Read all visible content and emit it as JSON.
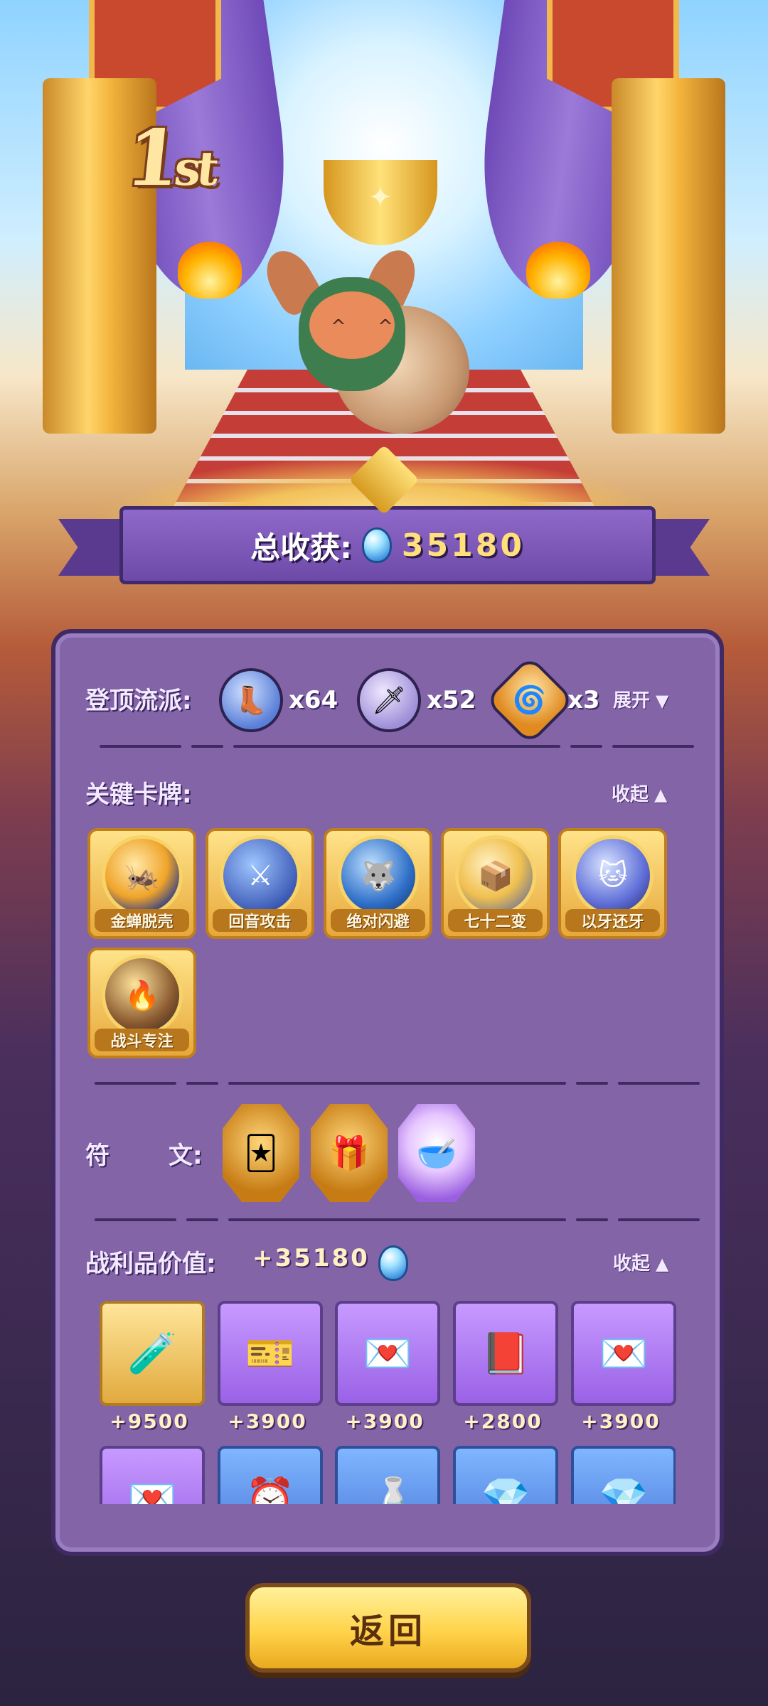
{
  "rank": {
    "num": "1",
    "suffix": "st"
  },
  "total": {
    "label": "总收获:",
    "value": "35180"
  },
  "faction": {
    "label": "登顶流派:",
    "items": [
      {
        "icon": "boot-icon",
        "count": "x64"
      },
      {
        "icon": "sword-icon",
        "count": "x52"
      },
      {
        "icon": "swirl-icon",
        "count": "x3"
      }
    ],
    "toggle": "展开"
  },
  "key_cards": {
    "label": "关键卡牌:",
    "toggle": "收起",
    "items": [
      "金蝉脱壳",
      "回音攻击",
      "绝对闪避",
      "七十二变",
      "以牙还牙",
      "战斗专注"
    ]
  },
  "runes": {
    "label_a": "符",
    "label_b": "文:"
  },
  "loot": {
    "label": "战利品价值:",
    "value": "+35180",
    "toggle": "收起",
    "items": [
      {
        "icon": "potion-icon",
        "value": "+9500"
      },
      {
        "icon": "vip-ticket-icon",
        "value": "+3900"
      },
      {
        "icon": "letter-icon",
        "value": "+3900"
      },
      {
        "icon": "red-book-icon",
        "value": "+2800"
      },
      {
        "icon": "letter-icon",
        "value": "+3900"
      }
    ],
    "partial_items": [
      "letter-icon",
      "alarm-clock-icon",
      "bottle-icon",
      "crystal-icon",
      "crystal-icon"
    ]
  },
  "back_button": "返回"
}
